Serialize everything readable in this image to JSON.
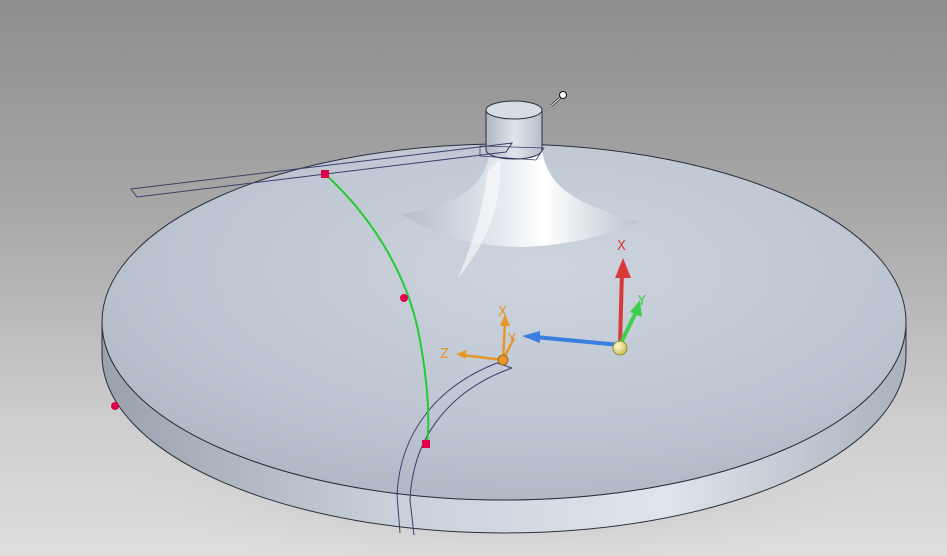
{
  "viewport": {
    "background_top": "#8e8e8e",
    "background_bottom": "#dedede"
  },
  "model": {
    "surface_color": "#bcc5d2",
    "edge_color": "#2a2f3a"
  },
  "sketch": {
    "curve_color": "#22cc33",
    "point_color": "#e0004a",
    "outline_color": "#3a3f6a"
  },
  "triad_main": {
    "x_label": "X",
    "y_label": "Y",
    "x_color": "#d83a3a",
    "y_color": "#3bd04a",
    "z_color": "#3a7ee0",
    "origin_color": "#e9e27a"
  },
  "triad_secondary": {
    "x_label": "X",
    "y_label": "Y",
    "z_label": "Z",
    "color": "#e8962a"
  },
  "cursor": {
    "icon": "pin-cursor-icon"
  }
}
